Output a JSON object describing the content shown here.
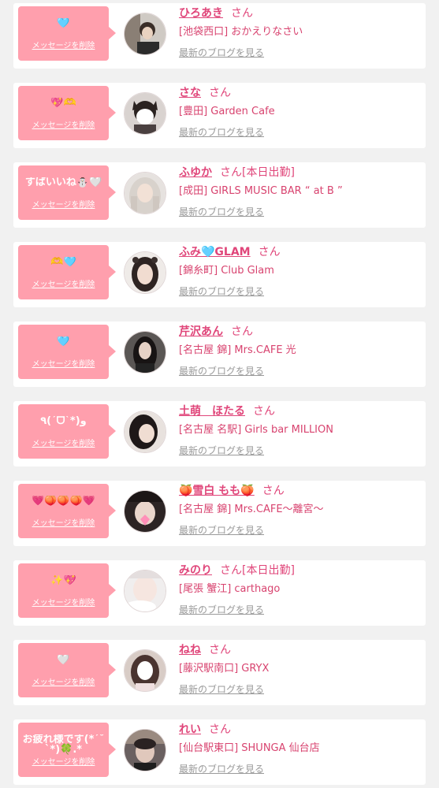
{
  "entries": [
    {
      "message": "🩵",
      "delete_label": "メッセージを削除",
      "name": "ひろあき",
      "san": "さん",
      "badge": "",
      "shop": "[池袋西口] おかえりなさい",
      "blog_label": "最新のブログを見る"
    },
    {
      "message": "💖🫶",
      "delete_label": "メッセージを削除",
      "name": "さな",
      "san": "さん",
      "badge": "",
      "shop": "[豊田] Garden Cafe",
      "blog_label": "最新のブログを見る"
    },
    {
      "message": "すばいいね⛄🤍",
      "delete_label": "メッセージを削除",
      "name": "ふゆか",
      "san": "さん",
      "badge": "[本日出勤]",
      "shop": "[成田] GIRLS MUSIC BAR “ at B ”",
      "blog_label": "最新のブログを見る"
    },
    {
      "message": "🫶🩵",
      "delete_label": "メッセージを削除",
      "name": "ふみ🩵GLAM",
      "san": "さん",
      "badge": "",
      "shop": "[錦糸町] Club Glam",
      "blog_label": "最新のブログを見る"
    },
    {
      "message": "🩵",
      "delete_label": "メッセージを削除",
      "name": "芹沢あん",
      "san": "さん",
      "badge": "",
      "shop": "[名古屋 錦] Mrs.CAFE 光",
      "blog_label": "最新のブログを見る"
    },
    {
      "message": "٩(ˊᗜˋ*)و",
      "delete_label": "メッセージを削除",
      "name": "土萌　ほたる",
      "san": "さん",
      "badge": "",
      "shop": "[名古屋 名駅] Girls bar MILLION",
      "blog_label": "最新のブログを見る"
    },
    {
      "message": "💗🍑🍑🍑💗",
      "delete_label": "メッセージを削除",
      "name": "🍑雪白 もも🍑",
      "san": "さん",
      "badge": "",
      "shop": "[名古屋 錦] Mrs.CAFE～離宮～",
      "blog_label": "最新のブログを見る"
    },
    {
      "message": "✨💖",
      "delete_label": "メッセージを削除",
      "name": "みのり",
      "san": "さん",
      "badge": "[本日出勤]",
      "shop": "[尾張 蟹江] carthago",
      "blog_label": "最新のブログを見る"
    },
    {
      "message": "🤍",
      "delete_label": "メッセージを削除",
      "name": "ねね",
      "san": "さん",
      "badge": "",
      "shop": "[藤沢駅南口] GRYX",
      "blog_label": "最新のブログを見る"
    },
    {
      "message": "お疲れ様です(*´˘`*)🍀.*",
      "delete_label": "メッセージを削除",
      "name": "れい",
      "san": "さん",
      "badge": "",
      "shop": "[仙台駅東口] SHUNGA 仙台店",
      "blog_label": "最新のブログを見る"
    }
  ]
}
